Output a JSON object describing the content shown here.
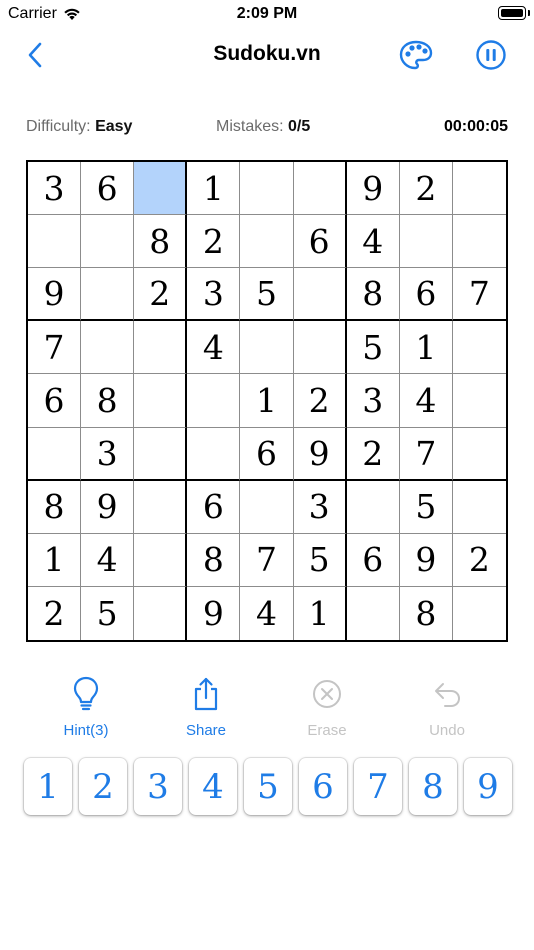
{
  "status_bar": {
    "carrier": "Carrier",
    "time": "2:09 PM"
  },
  "nav": {
    "title": "Sudoku.vn",
    "accent_color": "#1f7ce6"
  },
  "info": {
    "difficulty_label": "Difficulty:",
    "difficulty_value": "Easy",
    "mistakes_label": "Mistakes:",
    "mistakes_value": "0/5",
    "timer": "00:00:05"
  },
  "board": {
    "selected_cell": [
      0,
      2
    ],
    "selected_color": "#b3d3fb",
    "grid": [
      [
        "3",
        "6",
        "",
        "1",
        "",
        "",
        "9",
        "2",
        ""
      ],
      [
        "",
        "",
        "8",
        "2",
        "",
        "6",
        "4",
        "",
        ""
      ],
      [
        "9",
        "",
        "2",
        "3",
        "5",
        "",
        "8",
        "6",
        "7"
      ],
      [
        "7",
        "",
        "",
        "4",
        "",
        "",
        "5",
        "1",
        ""
      ],
      [
        "6",
        "8",
        "",
        "",
        "1",
        "2",
        "3",
        "4",
        ""
      ],
      [
        "",
        "3",
        "",
        "",
        "6",
        "9",
        "2",
        "7",
        ""
      ],
      [
        "8",
        "9",
        "",
        "6",
        "",
        "3",
        "",
        "5",
        ""
      ],
      [
        "1",
        "4",
        "",
        "8",
        "7",
        "5",
        "6",
        "9",
        "2"
      ],
      [
        "2",
        "5",
        "",
        "9",
        "4",
        "1",
        "",
        "8",
        ""
      ]
    ]
  },
  "tools": {
    "hint": {
      "label": "Hint(3)",
      "icon": "lightbulb-icon",
      "enabled": true
    },
    "share": {
      "label": "Share",
      "icon": "share-icon",
      "enabled": true
    },
    "erase": {
      "label": "Erase",
      "icon": "erase-icon",
      "enabled": false
    },
    "undo": {
      "label": "Undo",
      "icon": "undo-icon",
      "enabled": false
    }
  },
  "number_pad": [
    "1",
    "2",
    "3",
    "4",
    "5",
    "6",
    "7",
    "8",
    "9"
  ]
}
